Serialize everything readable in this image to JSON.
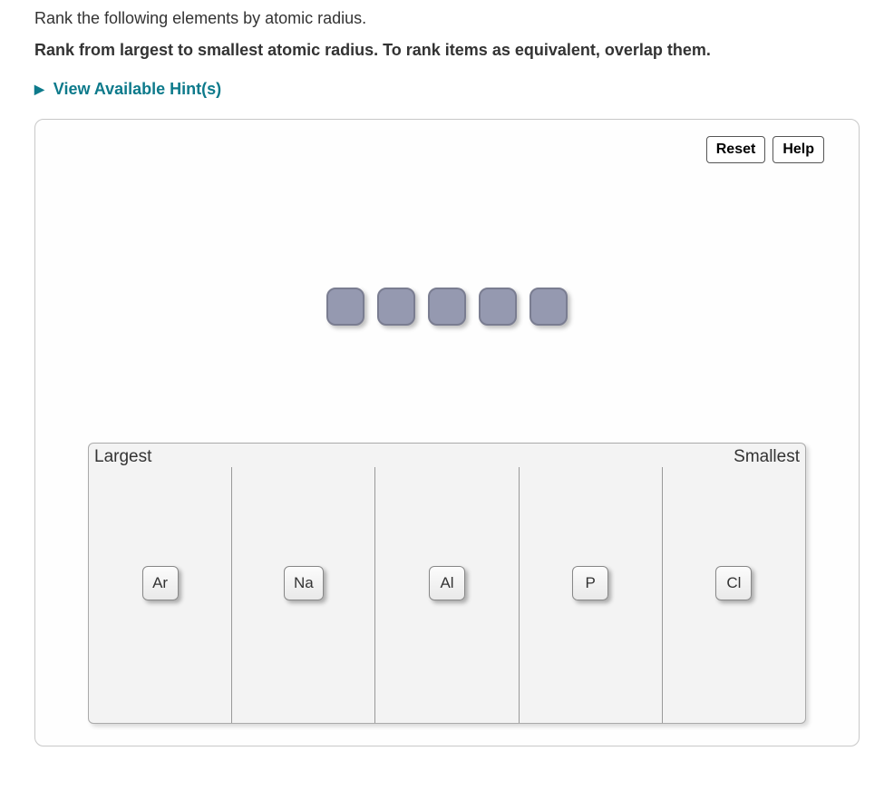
{
  "question": "Rank the following elements by atomic radius.",
  "instruction": "Rank from largest to smallest atomic radius. To rank items as equivalent, overlap them.",
  "hints_link": "View Available Hint(s)",
  "toolbar": {
    "reset": "Reset",
    "help": "Help"
  },
  "slots_count": 5,
  "rank_labels": {
    "left": "Largest",
    "right": "Smallest"
  },
  "bins": [
    {
      "chip": "Ar"
    },
    {
      "chip": "Na"
    },
    {
      "chip": "Al"
    },
    {
      "chip": "P"
    },
    {
      "chip": "Cl"
    }
  ]
}
